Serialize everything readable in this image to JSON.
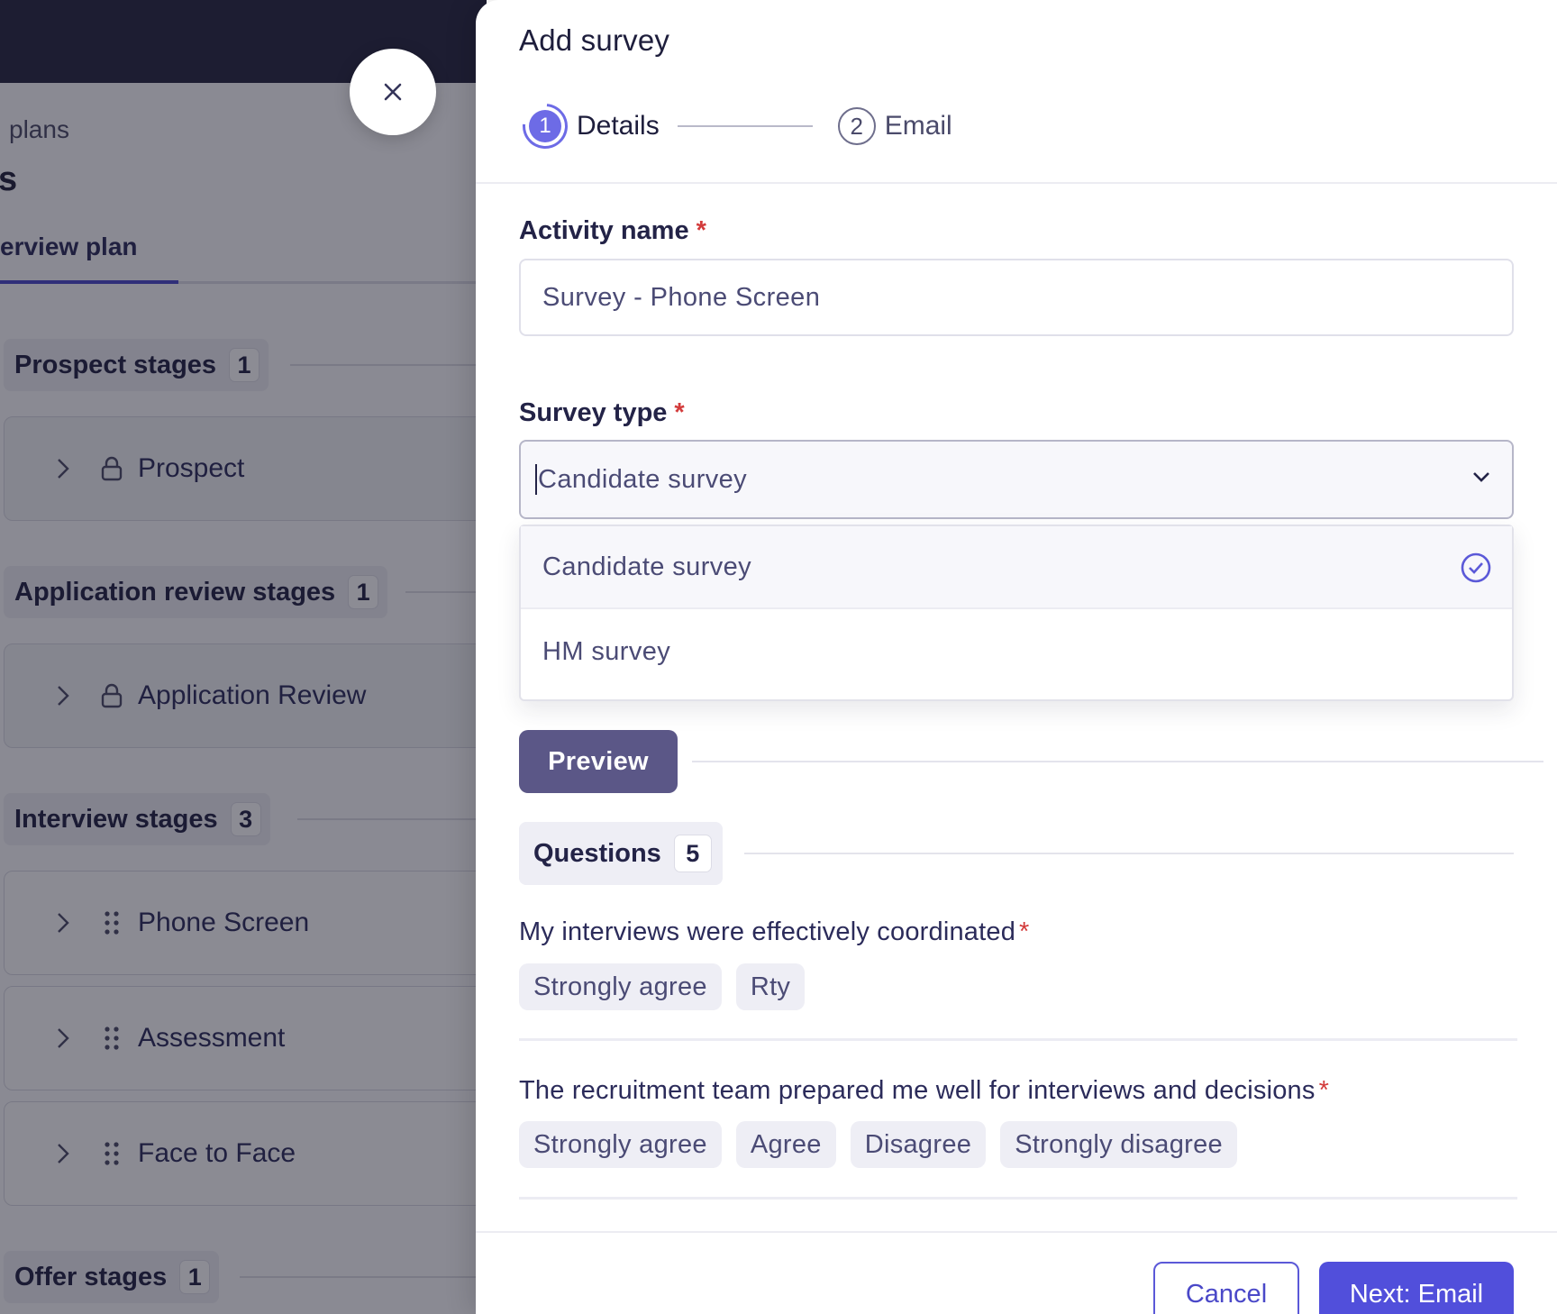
{
  "background": {
    "breadcrumb": "plans",
    "title": "s",
    "tab": "erview plan",
    "stages": [
      {
        "name": "Prospect stages",
        "count": "1",
        "items": [
          {
            "label": "Prospect",
            "icon": "lock-icon"
          }
        ]
      },
      {
        "name": "Application review stages",
        "count": "1",
        "items": [
          {
            "label": "Application Review",
            "icon": "lock-icon"
          }
        ]
      },
      {
        "name": "Interview stages",
        "count": "3",
        "items": [
          {
            "label": "Phone Screen",
            "icon": "drag-handle-icon"
          },
          {
            "label": "Assessment",
            "icon": "drag-handle-icon"
          },
          {
            "label": "Face to Face",
            "icon": "drag-handle-icon"
          }
        ]
      },
      {
        "name": "Offer stages",
        "count": "1",
        "items": []
      }
    ]
  },
  "drawer": {
    "title": "Add survey",
    "steps": [
      {
        "number": "1",
        "label": "Details",
        "active": true
      },
      {
        "number": "2",
        "label": "Email",
        "active": false
      }
    ],
    "activity_name": {
      "label": "Activity name",
      "required_mark": "*",
      "value": "Survey - Phone Screen"
    },
    "survey_type": {
      "label": "Survey type",
      "required_mark": "*",
      "value": "Candidate survey",
      "options": [
        {
          "label": "Candidate survey",
          "selected": true
        },
        {
          "label": "HM survey",
          "selected": false
        }
      ]
    },
    "preview_label": "Preview",
    "questions": {
      "label": "Questions",
      "count": "5",
      "items": [
        {
          "text": "My interviews were effectively coordinated",
          "required_mark": "*",
          "options": [
            "Strongly agree",
            "Rty"
          ]
        },
        {
          "text": "The recruitment team prepared me well for interviews and decisions",
          "required_mark": "*",
          "options": [
            "Strongly agree",
            "Agree",
            "Disagree",
            "Strongly disagree"
          ]
        }
      ]
    },
    "footer": {
      "cancel_label": "Cancel",
      "next_label": "Next: Email"
    }
  },
  "colors": {
    "accent": "#514fdb",
    "preview_button": "#5b5787",
    "required": "#d33b3b",
    "topbar": "#262640"
  }
}
